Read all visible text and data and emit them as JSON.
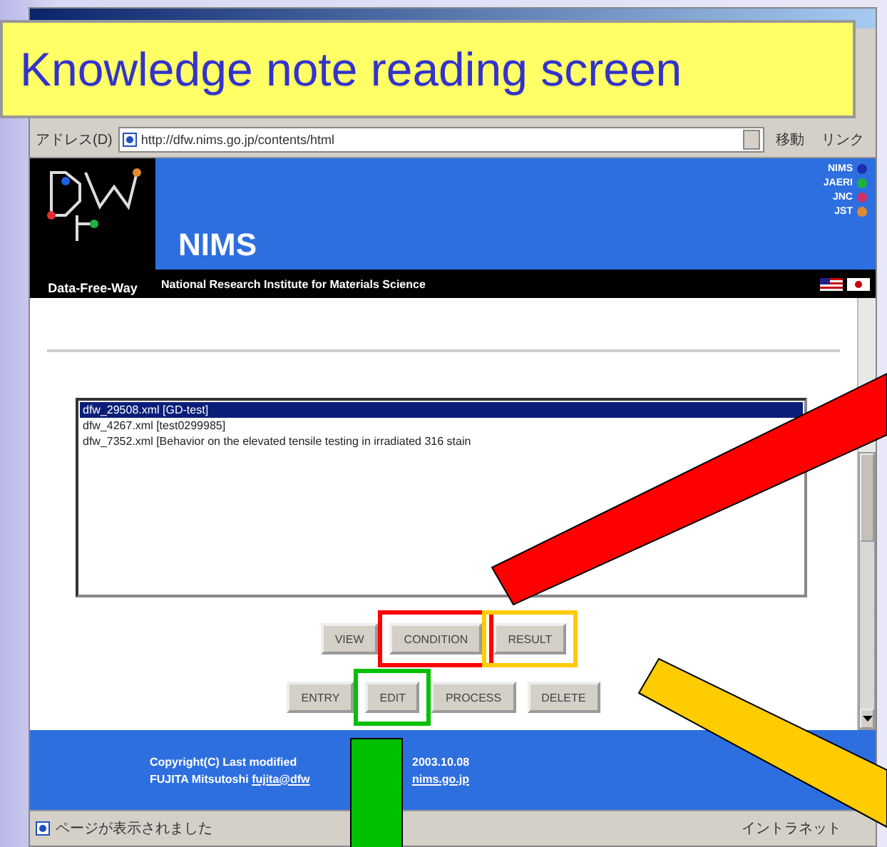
{
  "slide_title": "Knowledge note reading screen",
  "browser": {
    "address_label": "アドレス(D)",
    "url": "http://dfw.nims.go.jp/contents/html",
    "go_button": "移動",
    "links_button": "リンク"
  },
  "header": {
    "logo_caption": "Data-Free-Way",
    "site_name": "NIMS",
    "subtitle": "National Research Institute for Materials Science",
    "partners": [
      {
        "label": "NIMS",
        "color": "#1a2fb0"
      },
      {
        "label": "JAERI",
        "color": "#20b040"
      },
      {
        "label": "JNC",
        "color": "#d0306a"
      },
      {
        "label": "JST",
        "color": "#e08a30"
      }
    ]
  },
  "notes": [
    {
      "text": "dfw_29508.xml [GD-test]",
      "selected": true
    },
    {
      "text": "dfw_4267.xml [test0299985]",
      "selected": false
    },
    {
      "text": "dfw_7352.xml [Behavior on the elevated tensile testing in irradiated 316 stain",
      "selected": false
    }
  ],
  "button_rows": [
    [
      {
        "label": "VIEW"
      },
      {
        "label": "CONDITION",
        "color": "#ff0000"
      },
      {
        "label": "RESULT",
        "color": "#ffcc00"
      }
    ],
    [
      {
        "label": "ENTRY"
      },
      {
        "label": "EDIT",
        "color": "#00c000"
      },
      {
        "label": "PROCESS"
      },
      {
        "label": "DELETE"
      }
    ]
  ],
  "footer": {
    "copyright": "Copyright(C) Last modified",
    "date": "2003.10.08",
    "author": "FUJITA Mitsutoshi",
    "email_start": "fujita@dfw",
    "email_end": "nims.go.jp"
  },
  "status_bar": {
    "message": "ページが表示されました",
    "zone": "イントラネット"
  }
}
